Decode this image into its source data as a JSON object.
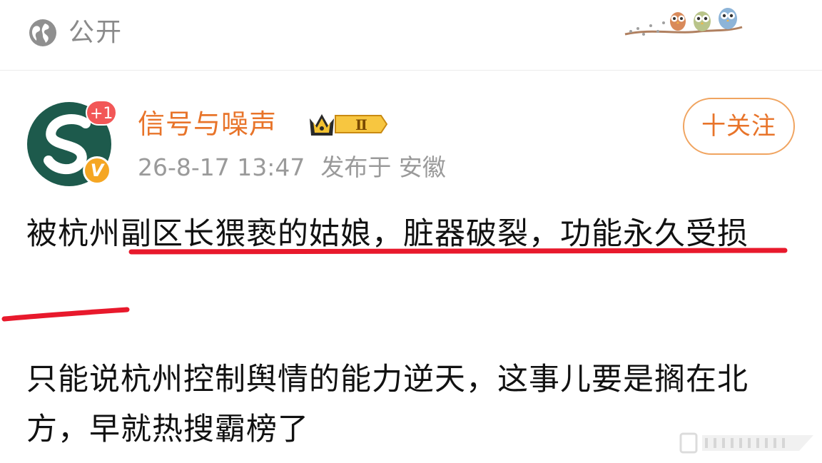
{
  "header": {
    "visibility_label": "公开",
    "icons": {
      "visibility": "globe-icon",
      "decoration": "owls-on-branch-icon"
    }
  },
  "author": {
    "name": "信号与噪声",
    "badge_level": "Ⅱ",
    "plus_badge": "+1",
    "verified_mark": "V",
    "timestamp": "26-8-17 13:47",
    "location": "发布于 安徽",
    "follow_label": "十关注"
  },
  "post": {
    "paragraphs": [
      "被杭州副区长猥亵的姑娘，脏器破裂，功能永久受损",
      "只能说杭州控制舆情的能力逆天，这事儿要是搁在北方，早就热搜霸榜了"
    ]
  },
  "colors": {
    "accent": "#e8742a",
    "underline": "#e8192c",
    "muted": "#9a9a9a",
    "avatar_bg": "#1d5a4c"
  }
}
